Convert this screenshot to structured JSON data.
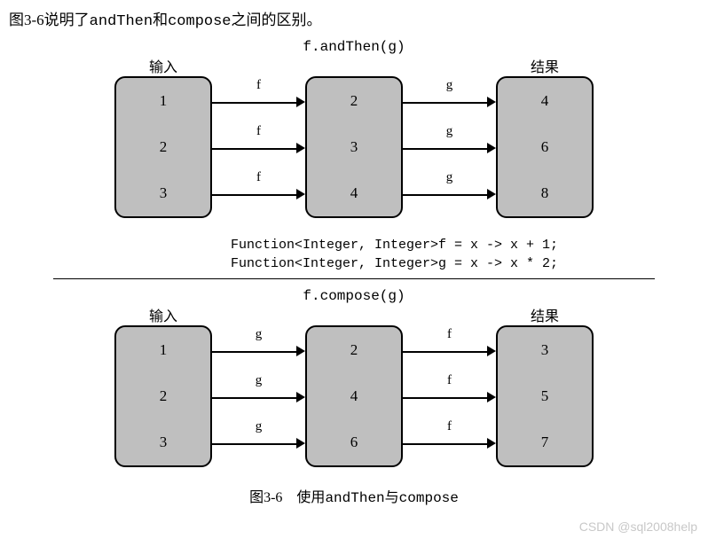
{
  "intro": {
    "pre": "图3-6说明了",
    "code1": "andThen",
    "mid": "和",
    "code2": "compose",
    "post": "之间的区别。"
  },
  "andThen": {
    "title": "f.andThen(g)",
    "inputLabel": "输入",
    "resultLabel": "结果",
    "box1": [
      "1",
      "2",
      "3"
    ],
    "arrows1": [
      "f",
      "f",
      "f"
    ],
    "box2": [
      "2",
      "3",
      "4"
    ],
    "arrows2": [
      "g",
      "g",
      "g"
    ],
    "box3": [
      "4",
      "6",
      "8"
    ]
  },
  "code": {
    "line1": "Function<Integer, Integer>f = x -> x + 1;",
    "line2": "Function<Integer, Integer>g = x -> x * 2;"
  },
  "compose": {
    "title": "f.compose(g)",
    "inputLabel": "输入",
    "resultLabel": "结果",
    "box1": [
      "1",
      "2",
      "3"
    ],
    "arrows1": [
      "g",
      "g",
      "g"
    ],
    "box2": [
      "2",
      "4",
      "6"
    ],
    "arrows2": [
      "f",
      "f",
      "f"
    ],
    "box3": [
      "3",
      "5",
      "7"
    ]
  },
  "caption": {
    "pre": "图3-6　使用",
    "code1": "andThen",
    "mid": "与",
    "code2": "compose"
  },
  "watermark": "CSDN @sql2008help",
  "chart_data": [
    {
      "type": "table",
      "title": "f.andThen(g)",
      "note": "f(x)=x+1 then g(x)=x*2",
      "input": [
        1,
        2,
        3
      ],
      "after_f": [
        2,
        3,
        4
      ],
      "result": [
        4,
        6,
        8
      ]
    },
    {
      "type": "table",
      "title": "f.compose(g)",
      "note": "g(x)=x*2 then f(x)=x+1",
      "input": [
        1,
        2,
        3
      ],
      "after_g": [
        2,
        4,
        6
      ],
      "result": [
        3,
        5,
        7
      ]
    }
  ]
}
